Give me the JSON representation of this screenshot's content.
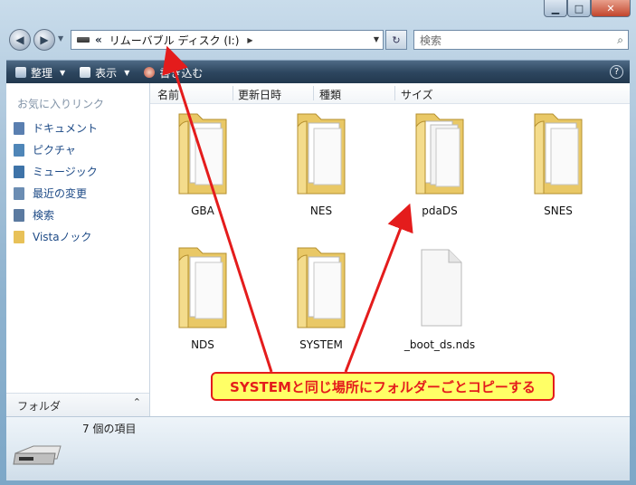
{
  "titlebar": {
    "minimize": "▁",
    "maximize": "□",
    "close": "✕"
  },
  "nav": {
    "back_glyph": "◀",
    "forward_glyph": "▶",
    "address_prefix": "«",
    "address_text": "リムーバブル ディスク (I:)",
    "address_arrow": "▶",
    "dropdown_glyph": "▼",
    "refresh_glyph": "↻",
    "search_placeholder": "検索",
    "search_icon_glyph": "⌕"
  },
  "toolbar": {
    "items": [
      {
        "label": "整理",
        "icon": "organize-icon",
        "caret": "▼"
      },
      {
        "label": "表示",
        "icon": "views-icon",
        "caret": "▼"
      },
      {
        "label": "書き込む",
        "icon": "burn-icon"
      }
    ],
    "help_glyph": "?"
  },
  "navpane": {
    "header": "お気に入りリンク",
    "links": [
      {
        "label": "ドキュメント",
        "icon": "documents-icon",
        "color": "#5a7fb0"
      },
      {
        "label": "ピクチャ",
        "icon": "pictures-icon",
        "color": "#4f86b8"
      },
      {
        "label": "ミュージック",
        "icon": "music-icon",
        "color": "#3e73a8"
      },
      {
        "label": "最近の変更",
        "icon": "recent-changes-icon",
        "color": "#6b8db3"
      },
      {
        "label": "検索",
        "icon": "search-icon",
        "color": "#5b7aa0"
      },
      {
        "label": "Vistaノック",
        "icon": "folder-icon",
        "color": "#e8c158"
      }
    ],
    "folders_label": "フォルダ",
    "folders_chevron": "⌃"
  },
  "columns": [
    "名前",
    "更新日時",
    "種類",
    "サイズ"
  ],
  "items": [
    {
      "name": "GBA",
      "type": "folder"
    },
    {
      "name": "NES",
      "type": "folder"
    },
    {
      "name": "pdaDS",
      "type": "folder"
    },
    {
      "name": "SNES",
      "type": "folder"
    },
    {
      "name": "NDS",
      "type": "folder"
    },
    {
      "name": "SYSTEM",
      "type": "folder"
    },
    {
      "name": "_boot_ds.nds",
      "type": "file"
    }
  ],
  "status": {
    "count_text": "7 個の項目",
    "icon": "removable-drive-icon"
  },
  "annotation": {
    "text": "SYSTEMと同じ場所にフォルダーごとコピーする",
    "color": "#e41c1c",
    "background": "#ffff66"
  }
}
